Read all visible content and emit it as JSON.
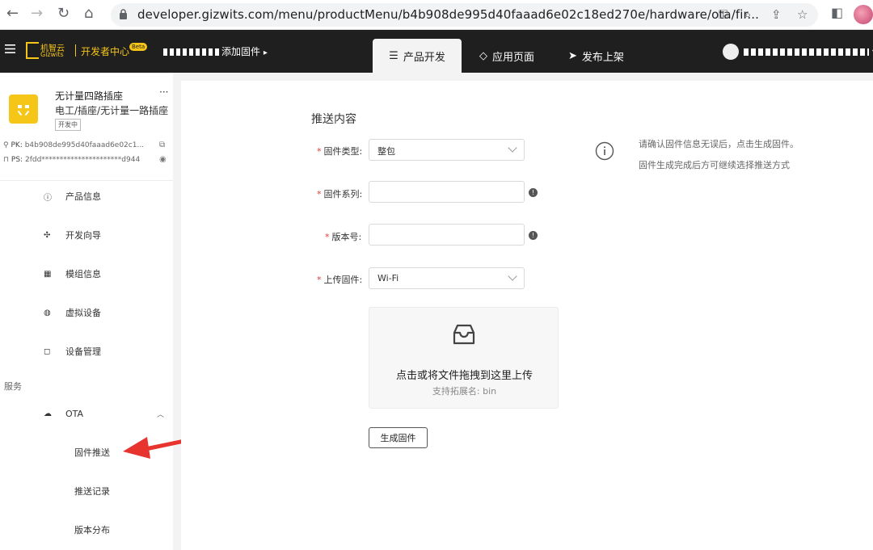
{
  "browser": {
    "url": "developer.gizwits.com/menu/productMenu/b4b908de995d40faaad6e02c18ed270e/hardware/ota/fir..."
  },
  "header": {
    "brand_cn": "机智云",
    "brand_en": "Gizwits",
    "dev_center": "开发者中心",
    "beta": "Beta",
    "product_selector": "添加固件",
    "tabs": [
      {
        "label": "产品开发",
        "icon": "sliders-icon"
      },
      {
        "label": "应用页面",
        "icon": "diamond-icon"
      },
      {
        "label": "发布上架",
        "icon": "send-icon"
      }
    ]
  },
  "sidebar": {
    "product_name": "无计量四路插座",
    "product_category": "电工/插座/无计量一路插座",
    "product_status": "开发中",
    "pk_label": "PK:",
    "pk_value": "b4b908de995d40faaad6e02c1...",
    "ps_label": "PS:",
    "ps_value": "2fdd**********************d944",
    "menu": [
      {
        "label": "产品信息",
        "icon": "info-icon"
      },
      {
        "label": "开发向导",
        "icon": "signpost-icon"
      },
      {
        "label": "模组信息",
        "icon": "module-icon"
      },
      {
        "label": "虚拟设备",
        "icon": "globe-icon"
      },
      {
        "label": "设备管理",
        "icon": "device-icon"
      }
    ],
    "section_label": "服务",
    "ota": {
      "label": "OTA",
      "icon": "cloud-icon"
    },
    "ota_sub": [
      "固件推送",
      "推送记录",
      "版本分布"
    ]
  },
  "main": {
    "section_title": "推送内容",
    "fields": {
      "firmware_type": {
        "label": "固件类型:",
        "value": "整包"
      },
      "firmware_series": {
        "label": "固件系列:",
        "value": ""
      },
      "version": {
        "label": "版本号:",
        "value": ""
      },
      "upload_firmware": {
        "label": "上传固件:",
        "value": "Wi-Fi"
      }
    },
    "upload": {
      "text": "点击或将文件拖拽到这里上传",
      "hint": "支持拓展名: bin"
    },
    "generate_button": "生成固件",
    "info_lines": [
      "请确认固件信息无误后，点击生成固件。",
      "固件生成完成后方可继续选择推送方式"
    ]
  },
  "colors": {
    "brand_yellow": "#f5c518",
    "header_bg": "#1f1f1f",
    "required_red": "#e03b3b",
    "arrow_red": "#e8342e"
  }
}
